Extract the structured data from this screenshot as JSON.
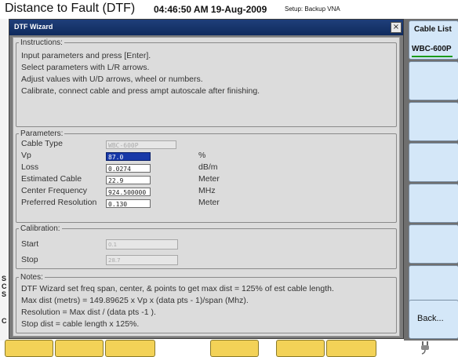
{
  "header": {
    "title": "Distance to Fault (DTF)",
    "datetime": "04:46:50 AM 19-Aug-2009",
    "setup": "Setup: Backup VNA"
  },
  "dialog": {
    "title": "DTF Wizard",
    "close_label": "×",
    "instructions": {
      "legend": "Instructions:",
      "lines": [
        "Input parameters and press [Enter].",
        "Select parameters with L/R arrows.",
        "Adjust values with U/D arrows, wheel or numbers.",
        "Calibrate, connect cable and press ampt autoscale after finishing."
      ]
    },
    "parameters": {
      "legend": "Parameters:",
      "rows": [
        {
          "label": "Cable Type",
          "value": "WBC-600P",
          "unit": ""
        },
        {
          "label": "Vp",
          "value": "87.0",
          "unit": "%"
        },
        {
          "label": "Loss",
          "value": "0.0274",
          "unit": "dB/m"
        },
        {
          "label": "Estimated Cable",
          "value": "22.9",
          "unit": "Meter"
        },
        {
          "label": "Center Frequency",
          "value": "924.500000",
          "unit": "MHz"
        },
        {
          "label": "Preferred Resolution",
          "value": "0.130",
          "unit": "Meter"
        }
      ]
    },
    "calibration": {
      "legend": "Calibration:",
      "start_label": "Start",
      "start_value": "0.1",
      "stop_label": "Stop",
      "stop_value": "28.7"
    },
    "notes": {
      "legend": "Notes:",
      "lines": [
        "DTF Wizard set freq span, center, & points to get max dist = 125% of est cable length.",
        "Max dist (metrs) = 149.89625 x Vp x (data pts - 1)/span (Mhz).",
        "Resolution = Max dist / (data pts -1 ).",
        "Stop dist = cable length x 125%."
      ]
    }
  },
  "softkeys": {
    "cable_list_label": "Cable List",
    "cable_list_value": "WBC-600P",
    "back_label": "Back..."
  },
  "background": {
    "left_fragments": [
      "S",
      "C",
      "S",
      "C"
    ]
  },
  "colors": {
    "titlebar": "#1f3f7a",
    "softkey_bg": "#d4e7f8",
    "tab_yellow": "#f3d257",
    "selected_field": "#1738a8"
  }
}
